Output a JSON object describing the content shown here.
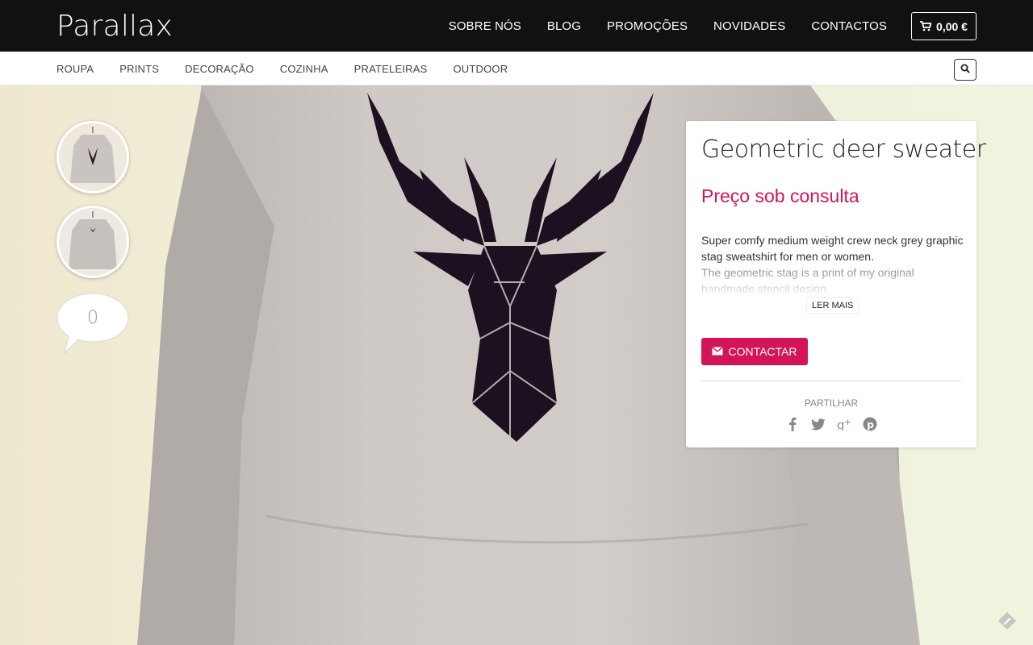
{
  "header": {
    "logo": "Parallax",
    "nav": [
      "SOBRE NÓS",
      "BLOG",
      "PROMOÇÕES",
      "NOVIDADES",
      "CONTACTOS"
    ],
    "cart_total": "0,00 €",
    "cart_icon": "shopping-cart-icon"
  },
  "subnav": {
    "items": [
      "ROUPA",
      "PRINTS",
      "DECORAÇÃO",
      "COZINHA",
      "PRATELEIRAS",
      "OUTDOOR"
    ],
    "search_icon": "search-icon"
  },
  "gallery": {
    "comments_count": "0"
  },
  "product": {
    "title": "Geometric deer sweater",
    "price": "Preço sob consulta",
    "description": "Super comfy medium weight crew neck grey graphic stag sweatshirt for men or women.",
    "description_more": "The geometric stag is a print of my original handmade stencil design.",
    "read_more": "LER MAIS",
    "contact_button": "CONTACTAR",
    "share_label": "PARTILHAR",
    "share_icons": [
      "facebook-icon",
      "twitter-icon",
      "google-plus-icon",
      "pinterest-icon"
    ]
  },
  "colors": {
    "accent": "#d4145a",
    "topbar": "#000000"
  }
}
